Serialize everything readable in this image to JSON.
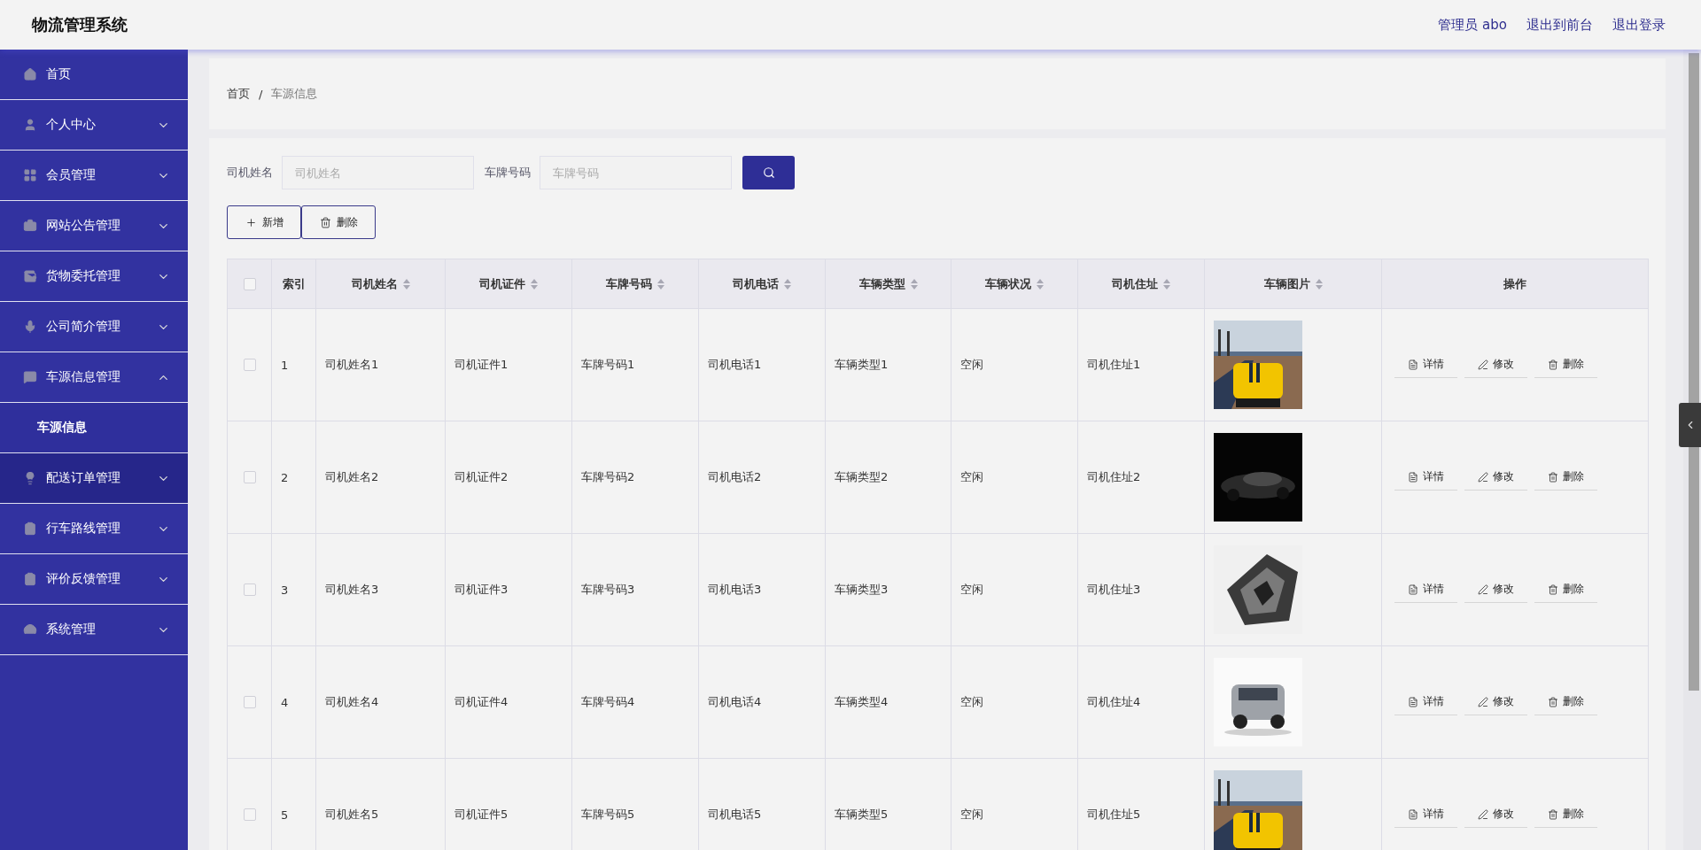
{
  "header": {
    "title": "物流管理系统",
    "links": [
      "管理员 abo",
      "退出到前台",
      "退出登录"
    ]
  },
  "sidebar": {
    "items": [
      {
        "label": "首页",
        "highlighted": false
      },
      {
        "label": "个人中心",
        "expanded": false,
        "highlighted": false
      },
      {
        "label": "会员管理",
        "expanded": false,
        "highlighted": false
      },
      {
        "label": "网站公告管理",
        "expanded": false,
        "highlighted": false
      },
      {
        "label": "货物委托管理",
        "expanded": false,
        "highlighted": false
      },
      {
        "label": "公司简介管理",
        "expanded": false,
        "highlighted": false
      },
      {
        "label": "车源信息管理",
        "expanded": true,
        "highlighted": false,
        "children": [
          {
            "label": "车源信息",
            "selected": true
          }
        ]
      },
      {
        "label": "配送订单管理",
        "expanded": false,
        "highlighted": true
      },
      {
        "label": "行车路线管理",
        "expanded": false,
        "highlighted": false
      },
      {
        "label": "评价反馈管理",
        "expanded": false,
        "highlighted": false
      },
      {
        "label": "系统管理",
        "expanded": false,
        "highlighted": false
      }
    ]
  },
  "breadcrumb": [
    "首页",
    "/",
    "车源信息"
  ],
  "search": {
    "fields": [
      {
        "label": "司机姓名",
        "placeholder": "司机姓名"
      },
      {
        "label": "车牌号码",
        "placeholder": "车牌号码"
      }
    ]
  },
  "toolbar": {
    "buttons": [
      {
        "label": "新增",
        "kind": "add"
      },
      {
        "label": "删除",
        "kind": "delete"
      }
    ]
  },
  "table": {
    "header_checked": false,
    "columns": [
      {
        "label": "索引",
        "sortable": false
      },
      {
        "label": "司机姓名",
        "sortable": true
      },
      {
        "label": "司机证件",
        "sortable": true
      },
      {
        "label": "车牌号码",
        "sortable": true
      },
      {
        "label": "司机电话",
        "sortable": true
      },
      {
        "label": "车辆类型",
        "sortable": true
      },
      {
        "label": "车辆状况",
        "sortable": true
      },
      {
        "label": "司机住址",
        "sortable": true
      },
      {
        "label": "车辆图片",
        "sortable": true
      },
      {
        "label": "操作",
        "sortable": false
      }
    ],
    "rows": [
      {
        "checked": false,
        "cells": [
          "1",
          "司机姓名1",
          "司机证件1",
          "车牌号码1",
          "司机电话1",
          "车辆类型1",
          "空闲",
          "司机住址1"
        ],
        "actions": [
          {
            "label": "详情",
            "kind": "detail"
          },
          {
            "label": "修改",
            "kind": "edit"
          },
          {
            "label": "删除",
            "kind": "delete"
          }
        ]
      },
      {
        "checked": false,
        "cells": [
          "2",
          "司机姓名2",
          "司机证件2",
          "车牌号码2",
          "司机电话2",
          "车辆类型2",
          "空闲",
          "司机住址2"
        ],
        "actions": [
          {
            "label": "详情",
            "kind": "detail"
          },
          {
            "label": "修改",
            "kind": "edit"
          },
          {
            "label": "删除",
            "kind": "delete"
          }
        ]
      },
      {
        "checked": false,
        "cells": [
          "3",
          "司机姓名3",
          "司机证件3",
          "车牌号码3",
          "司机电话3",
          "车辆类型3",
          "空闲",
          "司机住址3"
        ],
        "actions": [
          {
            "label": "详情",
            "kind": "detail"
          },
          {
            "label": "修改",
            "kind": "edit"
          },
          {
            "label": "删除",
            "kind": "delete"
          }
        ]
      },
      {
        "checked": false,
        "cells": [
          "4",
          "司机姓名4",
          "司机证件4",
          "车牌号码4",
          "司机电话4",
          "车辆类型4",
          "空闲",
          "司机住址4"
        ],
        "actions": [
          {
            "label": "详情",
            "kind": "detail"
          },
          {
            "label": "修改",
            "kind": "edit"
          },
          {
            "label": "删除",
            "kind": "delete"
          }
        ]
      },
      {
        "checked": false,
        "cells": [
          "5",
          "司机姓名5",
          "司机证件5",
          "车牌号码5",
          "司机电话5",
          "车辆类型5",
          "空闲",
          "司机住址5"
        ],
        "actions": [
          {
            "label": "详情",
            "kind": "detail"
          },
          {
            "label": "修改",
            "kind": "edit"
          },
          {
            "label": "删除",
            "kind": "delete"
          }
        ]
      }
    ]
  }
}
